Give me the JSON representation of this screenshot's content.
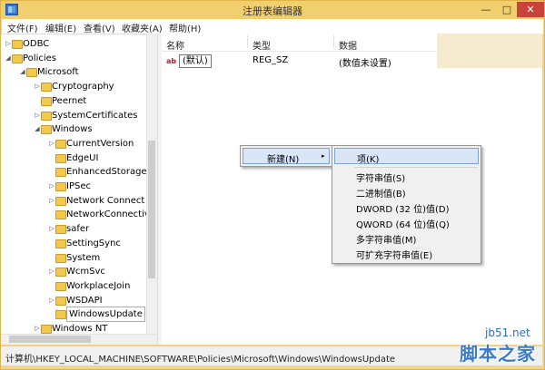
{
  "window": {
    "title": "注册表编辑器",
    "minimize_glyph": "—",
    "maximize_glyph": "□",
    "close_glyph": "✕"
  },
  "menubar": {
    "items": [
      "文件(F)",
      "编辑(E)",
      "查看(V)",
      "收藏夹(A)",
      "帮助(H)"
    ]
  },
  "tree": {
    "items": [
      {
        "label": "ODBC",
        "state": "collapsed",
        "level": 1
      },
      {
        "label": "Policies",
        "state": "expanded",
        "level": 1
      },
      {
        "label": "Microsoft",
        "state": "expanded",
        "level": 2
      },
      {
        "label": "Cryptography",
        "state": "collapsed",
        "level": 3
      },
      {
        "label": "Peernet",
        "state": "none",
        "level": 3
      },
      {
        "label": "SystemCertificates",
        "state": "collapsed",
        "level": 3
      },
      {
        "label": "Windows",
        "state": "expanded",
        "level": 3
      },
      {
        "label": "CurrentVersion",
        "state": "collapsed",
        "level": 4
      },
      {
        "label": "EdgeUI",
        "state": "none",
        "level": 4
      },
      {
        "label": "EnhancedStorage",
        "state": "none",
        "level": 4
      },
      {
        "label": "IPSec",
        "state": "collapsed",
        "level": 4
      },
      {
        "label": "Network Connect",
        "state": "collapsed",
        "level": 4
      },
      {
        "label": "NetworkConnectivi",
        "state": "none",
        "level": 4
      },
      {
        "label": "safer",
        "state": "collapsed",
        "level": 4
      },
      {
        "label": "SettingSync",
        "state": "none",
        "level": 4
      },
      {
        "label": "System",
        "state": "none",
        "level": 4
      },
      {
        "label": "WcmSvc",
        "state": "collapsed",
        "level": 4
      },
      {
        "label": "WorkplaceJoin",
        "state": "none",
        "level": 4
      },
      {
        "label": "WSDAPI",
        "state": "collapsed",
        "level": 4
      },
      {
        "label": "WindowsUpdate",
        "state": "none",
        "level": 4,
        "selected": true
      },
      {
        "label": "Windows NT",
        "state": "collapsed",
        "level": 3
      }
    ]
  },
  "list": {
    "columns": [
      "名称",
      "类型",
      "数据"
    ],
    "rows": [
      {
        "icon_text": "ab",
        "name": "(默认)",
        "type": "REG_SZ",
        "data": "(数值未设置)"
      }
    ]
  },
  "context_menu": {
    "new_label": "新建(N)",
    "submenu_glyph": "▸",
    "submenu": {
      "key_item": "项(K)",
      "items": [
        "字符串值(S)",
        "二进制值(B)",
        "DWORD (32 位)值(D)",
        "QWORD (64 位)值(Q)",
        "多字符串值(M)",
        "可扩充字符串值(E)"
      ]
    }
  },
  "status_bar": {
    "path": "计算机\\HKEY_LOCAL_MACHINE\\SOFTWARE\\Policies\\Microsoft\\Windows\\WindowsUpdate"
  },
  "watermark": {
    "url": "jb51.net",
    "site_name": "脚本之家"
  },
  "colors": {
    "title_bar": "#f2cf6e",
    "close_button": "#c8433a",
    "menu_highlight": "#d8e6f8",
    "folder": "#f2c94c"
  }
}
